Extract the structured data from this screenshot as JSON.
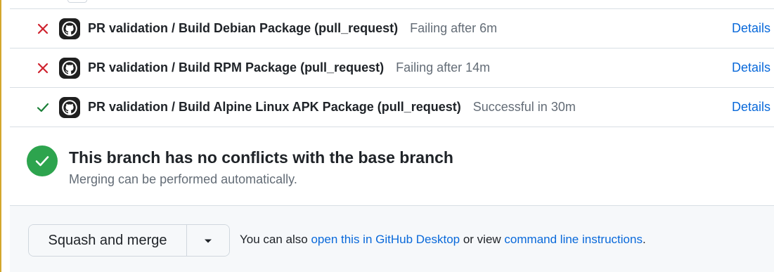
{
  "checks": [
    {
      "status": "failure",
      "status_icon": "x-icon",
      "app_icon": "github-icon",
      "title": "PR validation / Build Debian Package (pull_request)",
      "status_text": "Failing after 6m",
      "link": "Details"
    },
    {
      "status": "failure",
      "status_icon": "x-icon",
      "app_icon": "github-icon",
      "title": "PR validation / Build RPM Package (pull_request)",
      "status_text": "Failing after 14m",
      "link": "Details"
    },
    {
      "status": "success",
      "status_icon": "check-icon",
      "app_icon": "github-icon",
      "title": "PR validation / Build Alpine Linux APK Package (pull_request)",
      "status_text": "Successful in 30m",
      "link": "Details"
    }
  ],
  "conflicts": {
    "icon": "check-circle-icon",
    "title": "This branch has no conflicts with the base branch",
    "subtitle": "Merging can be performed automatically."
  },
  "merge": {
    "button_label": "Squash and merge",
    "dropdown_icon": "triangle-down-icon",
    "hint_prefix": "You can also ",
    "desktop_link": "open this in GitHub Desktop",
    "hint_middle": " or view ",
    "cli_link": "command line instructions",
    "hint_suffix": "."
  },
  "colors": {
    "failure": "#cf222e",
    "success": "#1a7f37",
    "link": "#0969da",
    "success_badge": "#2da44e",
    "accent_border": "#d4a72c"
  }
}
